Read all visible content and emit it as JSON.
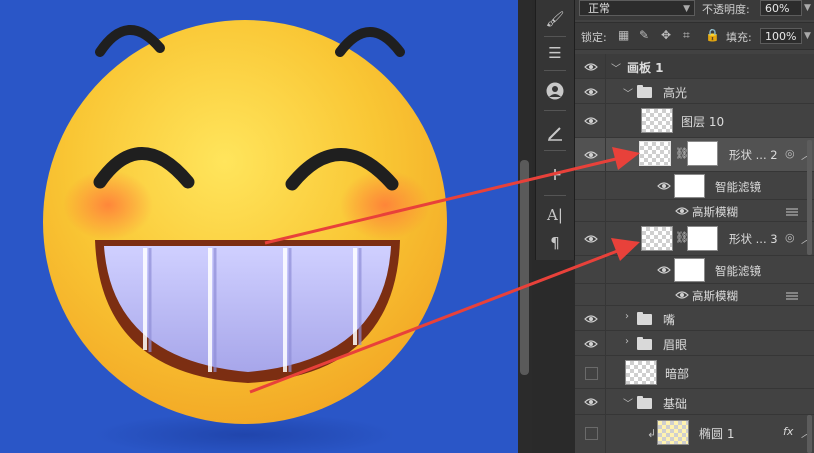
{
  "layers_panel": {
    "blend_mode": "正常",
    "opacity_label": "不透明度:",
    "opacity_value": "60%",
    "lock_label": "锁定:",
    "fill_label": "填充:",
    "fill_value": "100%",
    "layers": [
      {
        "name": "画板 1"
      },
      {
        "name": "高光"
      },
      {
        "name": "图层 10"
      },
      {
        "name": "形状 ... 2"
      },
      {
        "name": "智能滤镜"
      },
      {
        "name": "高斯模糊"
      },
      {
        "name": "形状 ... 3"
      },
      {
        "name": "智能滤镜"
      },
      {
        "name": "高斯模糊"
      },
      {
        "name": "嘴"
      },
      {
        "name": "眉眼"
      },
      {
        "name": "暗部"
      },
      {
        "name": "基础"
      },
      {
        "name": "椭圆 1"
      }
    ],
    "fx_label": "fx"
  },
  "tool_icons": [
    "brush-icon",
    "sliders-icon",
    "person-icon",
    "ruler-icon",
    "move-icon",
    "text-icon",
    "paragraph-icon"
  ],
  "colors": {
    "canvas_bg": "#2a56c7",
    "face_yellow": "#f7c533",
    "teeth": "#b7b6f2",
    "arrow_red": "#e8413a",
    "panel_bg": "#424242"
  }
}
